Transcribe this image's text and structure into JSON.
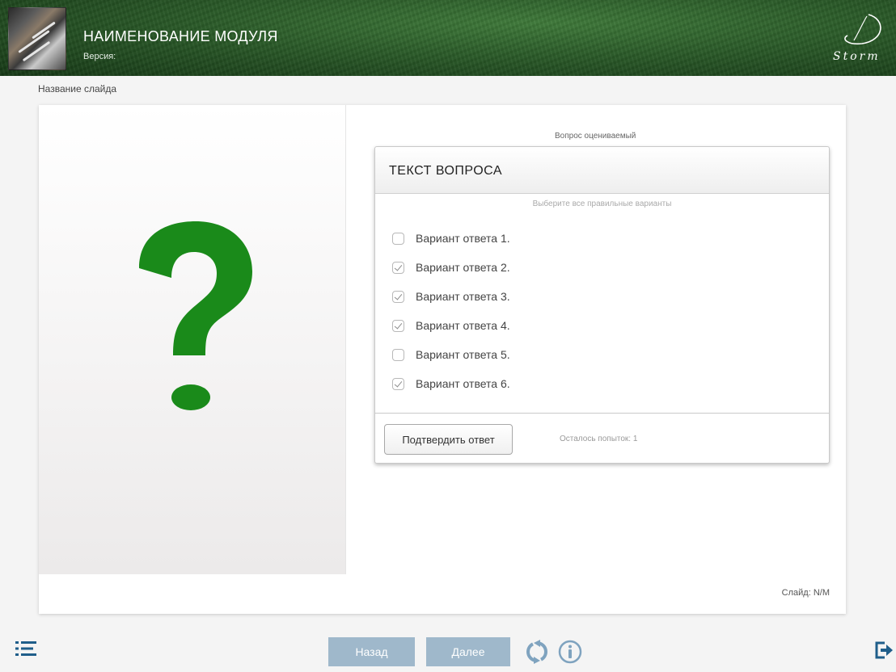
{
  "header": {
    "module_title": "НАИМЕНОВАНИЕ МОДУЛЯ",
    "version_label": "Версия:",
    "logo_text": "Storm"
  },
  "slide": {
    "name": "Название слайда",
    "counter": "Слайд: N/M",
    "image_icon": "question-mark-icon"
  },
  "question": {
    "type_label": "Вопрос оцениваемый",
    "title": "ТЕКСТ ВОПРОСА",
    "instruction": "Выберите все правильные варианты",
    "options": [
      {
        "label": "Вариант ответа 1.",
        "checked": false
      },
      {
        "label": "Вариант ответа 2.",
        "checked": true
      },
      {
        "label": "Вариант ответа 3.",
        "checked": true
      },
      {
        "label": "Вариант ответа 4.",
        "checked": true
      },
      {
        "label": "Вариант ответа 5.",
        "checked": false
      },
      {
        "label": "Вариант ответа 6.",
        "checked": true
      }
    ],
    "submit_label": "Подтвердить ответ",
    "attempts_label": "Осталось попыток: 1"
  },
  "nav": {
    "back_label": "Назад",
    "next_label": "Далее",
    "menu_icon": "list-icon",
    "reload_icon": "reload-icon",
    "info_icon": "info-icon",
    "exit_icon": "exit-icon"
  },
  "colors": {
    "accent_green": "#1a8a1a",
    "nav_button": "#9fb8cb",
    "icon_blue": "#7fa3bf",
    "header_green": "#2a5a28"
  }
}
